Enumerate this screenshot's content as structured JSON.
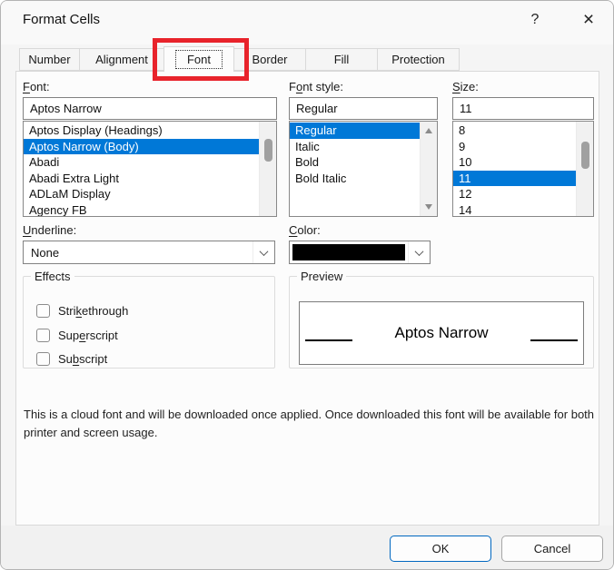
{
  "window": {
    "title": "Format Cells",
    "help_glyph": "?",
    "close_glyph": "×"
  },
  "tabs": [
    {
      "label": "Number",
      "active": false
    },
    {
      "label": "Alignment",
      "active": false
    },
    {
      "label": "Font",
      "active": true
    },
    {
      "label": "Border",
      "active": false
    },
    {
      "label": "Fill",
      "active": false
    },
    {
      "label": "Protection",
      "active": false
    }
  ],
  "font_section": {
    "label": {
      "pre": "",
      "key": "F",
      "post": "ont:"
    },
    "value": "Aptos Narrow",
    "items": [
      "Aptos Display (Headings)",
      "Aptos Narrow (Body)",
      "Abadi",
      "Abadi Extra Light",
      "ADLaM Display",
      "Agency FB"
    ],
    "selected": "Aptos Narrow (Body)"
  },
  "style_section": {
    "label": {
      "pre": "F",
      "key": "o",
      "post": "nt style:"
    },
    "value": "Regular",
    "items": [
      "Regular",
      "Italic",
      "Bold",
      "Bold Italic"
    ],
    "selected": "Regular"
  },
  "size_section": {
    "label": {
      "pre": "",
      "key": "S",
      "post": "ize:"
    },
    "value": "11",
    "items": [
      "8",
      "9",
      "10",
      "11",
      "12",
      "14"
    ],
    "selected": "11"
  },
  "underline_section": {
    "label": {
      "pre": "",
      "key": "U",
      "post": "nderline:"
    },
    "value": "None"
  },
  "color_section": {
    "label": {
      "pre": "",
      "key": "C",
      "post": "olor:"
    },
    "swatch_color": "#000000"
  },
  "effects": {
    "group_label": "Effects",
    "items": [
      {
        "pre": "Stri",
        "key": "k",
        "post": "ethrough",
        "checked": false
      },
      {
        "pre": "Sup",
        "key": "e",
        "post": "rscript",
        "checked": false
      },
      {
        "pre": "Su",
        "key": "b",
        "post": "script",
        "checked": false
      }
    ]
  },
  "preview": {
    "group_label": "Preview",
    "sample_text": "Aptos Narrow"
  },
  "note": "This is a cloud font and will be downloaded once applied. Once downloaded this font will be available for both printer and screen usage.",
  "buttons": {
    "ok": "OK",
    "cancel": "Cancel"
  },
  "colors": {
    "selection_blue": "#0078d7",
    "annotation_red": "#e8232b",
    "ok_border_blue": "#0067c0",
    "color_swatch": "#000000"
  },
  "annotation": {
    "type": "highlight-box",
    "target": "Font tab"
  }
}
